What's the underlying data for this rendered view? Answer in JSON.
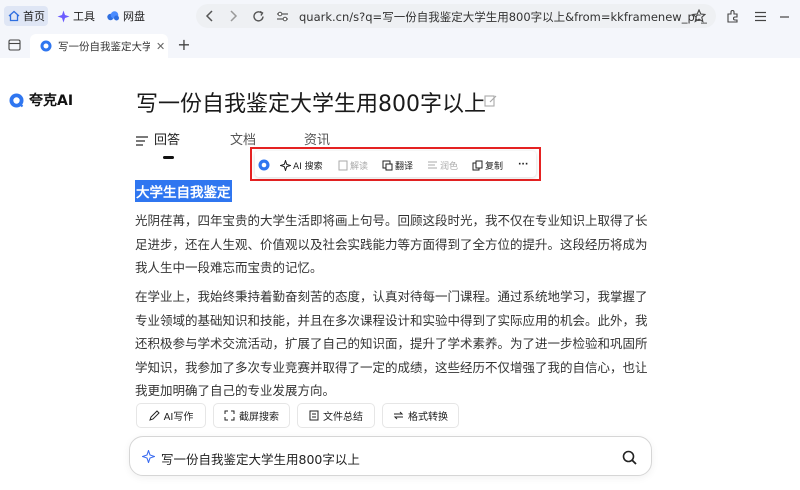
{
  "browser": {
    "bookmarks": [
      "首页",
      "工具",
      "网盘"
    ],
    "url": "quark.cn/s?q=写一份自我鉴定大学生用800字以上&from=kkframenew_pc_...",
    "tab_title": "写一份自我鉴定大学生"
  },
  "app": {
    "logo_text": "夸克AI",
    "title": "写一份自我鉴定大学生用800字以上",
    "tabs": [
      "回答",
      "文档",
      "资讯"
    ]
  },
  "selection_toolbar": {
    "items": [
      "AI 搜索",
      "解读",
      "翻译",
      "润色",
      "复制",
      "···"
    ]
  },
  "answer": {
    "heading": "大学生自我鉴定",
    "paragraph1": [
      "光阴荏苒，四年宝贵的大学生活即将画上句号。回顾这段时光，我不仅在专业知识上取得了长",
      "足进步，还在人生观、价值观以及社会实践能力等方面得到了全方位的提升。这段经历将成为",
      "我人生中一段难忘而宝贵的记忆。"
    ],
    "paragraph2": [
      "在学业上，我始终秉持着勤奋刻苦的态度，认真对待每一门课程。通过系统地学习，我掌握了",
      "专业领域的基础知识和技能，并且在多次课程设计和实验中得到了实际应用的机会。此外，我",
      "还积极参与学术交流活动，扩展了自己的知识面，提升了学术素养。为了进一步检验和巩固所",
      "学知识，我参加了多次专业竞赛并取得了一定的成绩，这些经历不仅增强了我的自信心，也让",
      "我更加明确了自己的专业发展方向。"
    ]
  },
  "actions": [
    "AI写作",
    "截屏搜索",
    "文件总结",
    "格式转换"
  ],
  "search": {
    "value": "写一份自我鉴定大学生用800字以上"
  },
  "colors": {
    "accent": "#2f76f0",
    "highlight_border": "#e52222"
  }
}
